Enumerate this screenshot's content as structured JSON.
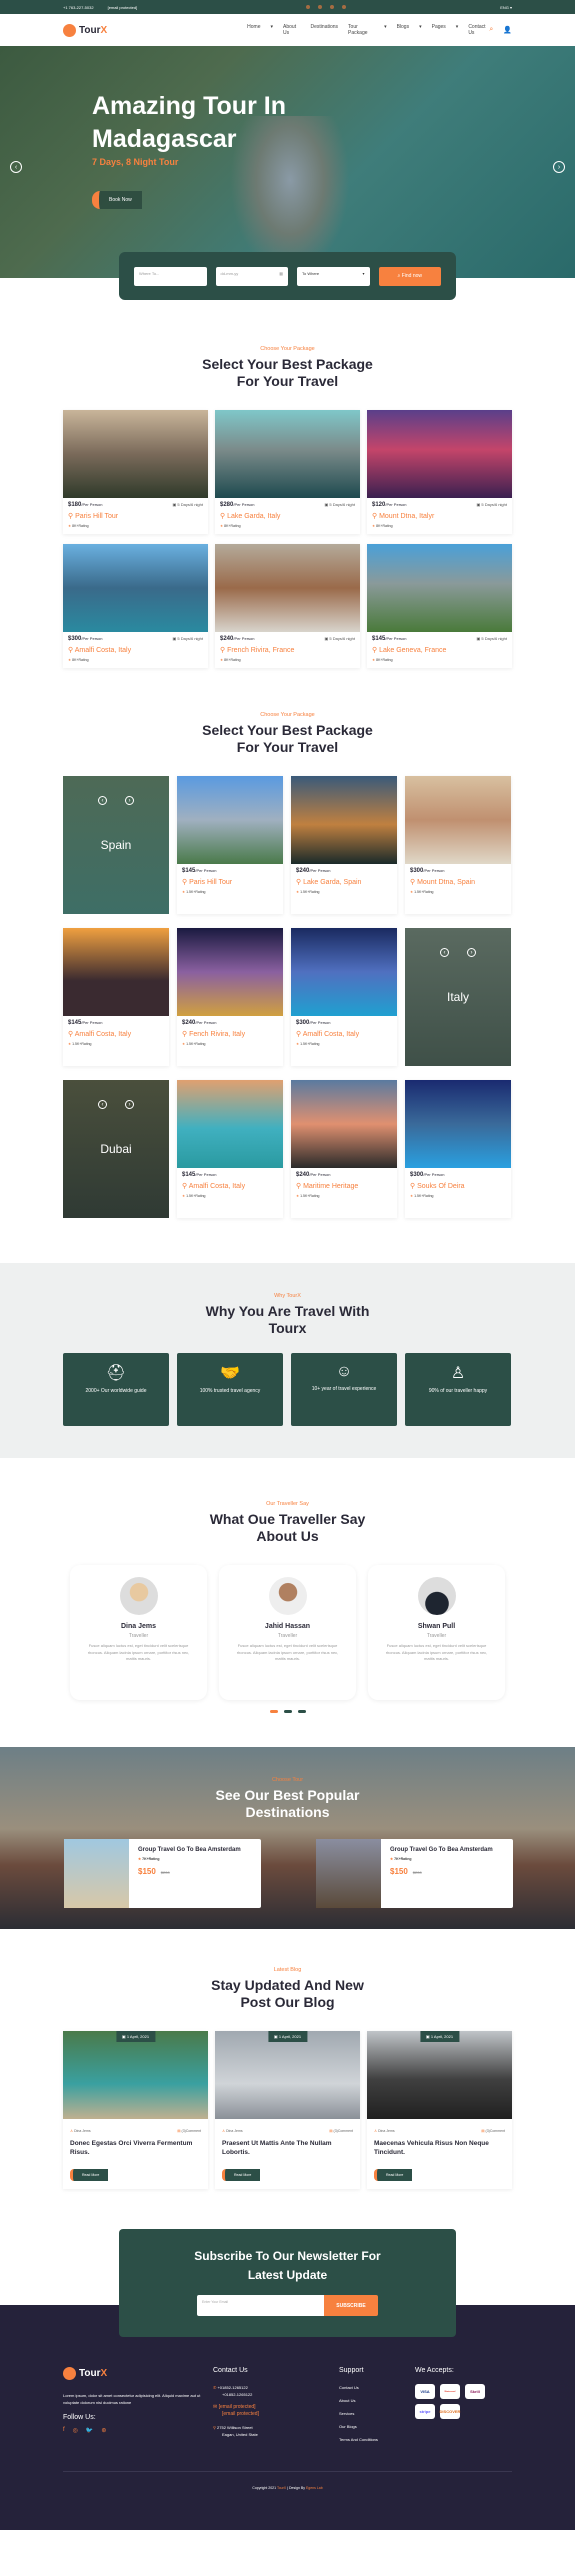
{
  "topbar": {
    "phone": "+1 763-227-5032",
    "email": "[email protected]",
    "lang": "ENG"
  },
  "brand": {
    "name": "Tour",
    "accent": "X"
  },
  "nav": {
    "items": [
      "Home",
      "About Us",
      "Destinations",
      "Tour Package",
      "Blogs",
      "Pages",
      "Contact Us"
    ]
  },
  "hero": {
    "title": "Amazing Tour In Madagascar",
    "subtitle": "7 Days, 8 Night Tour",
    "book": "Book Now"
  },
  "search": {
    "where_placeholder": "Where To...",
    "date_placeholder": "dd-mm-yy",
    "select": "To Where",
    "button": "Find now"
  },
  "packages": {
    "subtitle": "Choose Your Package",
    "title": "Select Your Best Package For Your Travel",
    "items": [
      {
        "price": "$180",
        "per": "/Per Person",
        "duration": "5 Days/6 night",
        "name": "Paris Hill Tour",
        "rating": "8K+Rating"
      },
      {
        "price": "$280",
        "per": "/Per Person",
        "duration": "5 Days/6 night",
        "name": "Lake Garda, Italy",
        "rating": "8K+Rating"
      },
      {
        "price": "$120",
        "per": "/Per Person",
        "duration": "5 Days/6 night",
        "name": "Mount Dtna, Italyr",
        "rating": "8K+Rating"
      },
      {
        "price": "$300",
        "per": "/Per Person",
        "duration": "5 Days/6 night",
        "name": "Amalfi Costa, Italy",
        "rating": "8K+Rating"
      },
      {
        "price": "$240",
        "per": "/Per Person",
        "duration": "5 Days/6 night",
        "name": "French Rivira, France",
        "rating": "8K+Rating"
      },
      {
        "price": "$145",
        "per": "/Per Person",
        "duration": "5 Days/6 night",
        "name": "Lake Geneva, France",
        "rating": "8K+Rating"
      }
    ]
  },
  "packages2": {
    "subtitle": "Choose Your Package",
    "title": "Select Your Best Package For Your Travel",
    "cities": [
      "Spain",
      "Italy",
      "Dubai"
    ],
    "items": [
      {
        "price": "$145",
        "per": "/Per Person",
        "name": "Paris Hill Tour",
        "rating": "1.5K+Rating"
      },
      {
        "price": "$240",
        "per": "/Per Person",
        "name": "Lake Garda, Spain",
        "rating": "1.5K+Rating"
      },
      {
        "price": "$300",
        "per": "/Per Person",
        "name": "Mount Dtna, Spain",
        "rating": "1.5K+Rating"
      },
      {
        "price": "$145",
        "per": "/Per Person",
        "name": "Amalfi Costa, Italy",
        "rating": "1.5K+Rating"
      },
      {
        "price": "$240",
        "per": "/Per Person",
        "name": "Fench Rivira, Italy",
        "rating": "1.5K+Rating"
      },
      {
        "price": "$300",
        "per": "/Per Person",
        "name": "Amalfi Costa, Italy",
        "rating": "1.5K+Rating"
      },
      {
        "price": "$145",
        "per": "/Per Person",
        "name": "Amalfi Costa, Italy",
        "rating": "1.5K+Rating"
      },
      {
        "price": "$240",
        "per": "/Per Person",
        "name": "Maritime Heritage",
        "rating": "1.5K+Rating"
      },
      {
        "price": "$300",
        "per": "/Per Person",
        "name": "Souks Of Deira",
        "rating": "1.5K+Rating"
      }
    ]
  },
  "why": {
    "subtitle": "Why TourX",
    "title": "Why You Are Travel With Tourx",
    "items": [
      "2000+ Our worldwide guide",
      "100% trusted travel agency",
      "10+ year of travel experience",
      "90% of our traveller happy"
    ]
  },
  "testimonials": {
    "subtitle": "Our Traveller Say",
    "title": "What Oue Traveller Say About Us",
    "items": [
      {
        "name": "Dina Jems",
        "role": "Traveller",
        "text": "Fusce aliquam luctus est, eget tincidunt velit scelerisque rhoncus. Aliquam lacinia ipsum ornare, porttitor risus nec, mattis mauris."
      },
      {
        "name": "Jahid Hassan",
        "role": "Traveller",
        "text": "Fusce aliquam luctus est, eget tincidunt velit scelerisque rhoncus. Aliquam lacinia ipsum ornare, porttitor risus nec, mattis mauris."
      },
      {
        "name": "Shwan Pull",
        "role": "Traveller",
        "text": "Fusce aliquam luctus est, eget tincidunt velit scelerisque rhoncus. Aliquam lacinia ipsum ornare, porttitor risus nec, mattis mauris."
      }
    ]
  },
  "popular": {
    "subtitle": "Choose Tour",
    "title": "See Our Best Popular Destinations",
    "items": [
      {
        "name": "Group Travel Go To Bea Amsterdam",
        "rating": "7K+Rating",
        "price": "$150",
        "old": "$200"
      },
      {
        "name": "Group Travel Go To Bea Amsterdam",
        "rating": "7K+Rating",
        "price": "$150",
        "old": "$200"
      }
    ]
  },
  "blog": {
    "subtitle": "Latest Blog",
    "title": "Stay Updated And New Post Our Blog",
    "items": [
      {
        "date": "1 April, 2021",
        "author": "Dina Jems",
        "comments": "(3)Comment",
        "title": "Donec Egestas Orci Viverra Fermentum Risus.",
        "read": "Read More"
      },
      {
        "date": "1 April, 2021",
        "author": "Dina Jems",
        "comments": "(3)Comment",
        "title": "Praesent Ut Mattis Ante The Nullam Lobortis.",
        "read": "Read More"
      },
      {
        "date": "1 April, 2021",
        "author": "Dina Jems",
        "comments": "(3)Comment",
        "title": "Maecenas Vehicula Risus Non Neque Tincidunt.",
        "read": "Read More"
      }
    ]
  },
  "newsletter": {
    "title": "Subscribe To Our Newsletter For Latest Update",
    "placeholder": "Enter Your Email",
    "button": "SUBSCRIBE"
  },
  "footer": {
    "about": "Lorem ipsum, dolor sit amet consectetur adipisicing elit. Aliquid maxime aut ut voluptate dolorum nisi ducimus ratione",
    "follow": "Follow Us:",
    "contact_title": "Contact Us",
    "phone1": "+01852-1265122",
    "phone2": "+01852-1265122",
    "email1": "[email protected]",
    "email2": "[email protected]",
    "addr1": "2752 Willison Street",
    "addr2": "Eagan, United State",
    "support_title": "Support",
    "support": [
      "Contact Us",
      "About Us",
      "Services",
      "Our Blogs",
      "Terms And Conditions"
    ],
    "accept_title": "We Accepts:",
    "payments": [
      "VISA",
      "Mastercard",
      "Skrill",
      "stripe",
      "DISCOVER"
    ],
    "copy_pre": "Copyright 2021",
    "copy_brand": "TourX",
    "copy_mid": "| Design By",
    "copy_designer": "Egens Lab"
  },
  "colors": {
    "primary": "#2c4f47",
    "accent": "#f7813f",
    "footer": "#25223a"
  }
}
